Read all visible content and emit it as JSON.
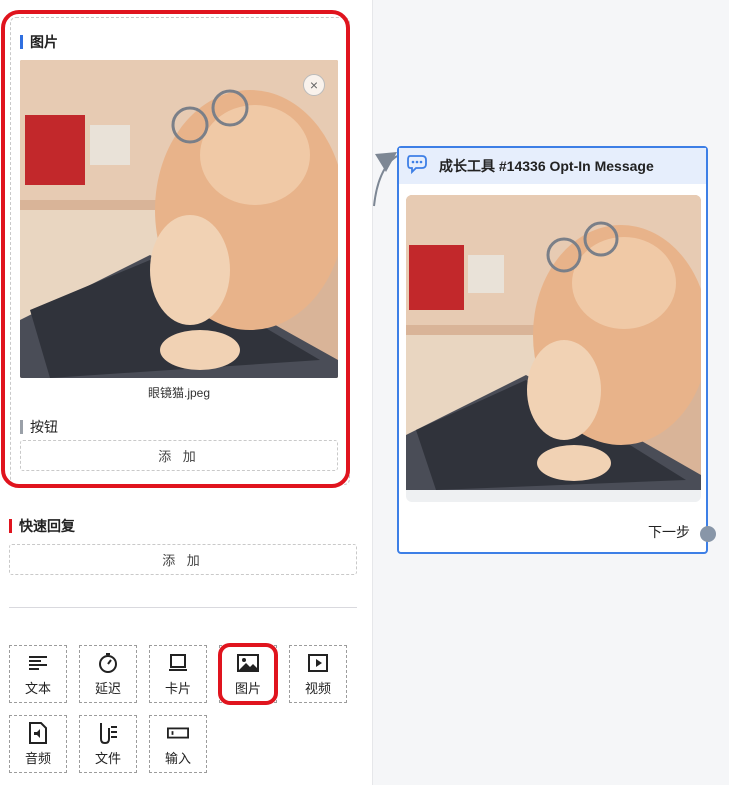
{
  "colors": {
    "accent_blue": "#3d7fe6",
    "highlight_red": "#e0141e",
    "canvas_bg": "#f5f6f8",
    "port_gray": "#8896a8"
  },
  "image_section": {
    "title": "图片",
    "close_icon": "×",
    "filename": "眼镜猫.jpeg"
  },
  "button_section": {
    "title": "按钮",
    "add_label": "添 加"
  },
  "quick_reply": {
    "title": "快速回复",
    "add_label": "添 加"
  },
  "toolbar": {
    "items": [
      {
        "label": "文本",
        "icon": "text-lines-icon"
      },
      {
        "label": "延迟",
        "icon": "stopwatch-icon"
      },
      {
        "label": "卡片",
        "icon": "card-icon"
      },
      {
        "label": "图片",
        "icon": "image-icon",
        "selected": true
      },
      {
        "label": "视频",
        "icon": "video-icon"
      },
      {
        "label": "音频",
        "icon": "audio-file-icon"
      },
      {
        "label": "文件",
        "icon": "file-icon"
      },
      {
        "label": "输入",
        "icon": "input-box-icon"
      }
    ]
  },
  "node": {
    "title": "成长工具 #14336 Opt-In Message",
    "icon": "chat-bubbles-icon",
    "next_label": "下一步"
  }
}
